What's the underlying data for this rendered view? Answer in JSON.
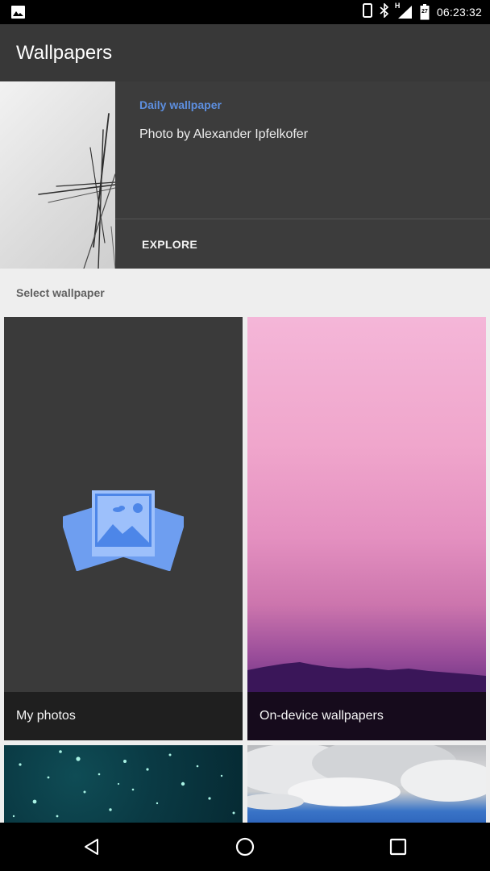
{
  "status_bar": {
    "time": "06:23:32",
    "network_label": "H",
    "battery_level": "27",
    "icons": [
      "gallery-notification-icon",
      "phone-icon",
      "bluetooth-icon",
      "signal-icon",
      "battery-icon"
    ]
  },
  "app_bar": {
    "title": "Wallpapers"
  },
  "daily": {
    "label": "Daily wallpaper",
    "credit": "Photo by Alexander Ipfelkofer",
    "explore_label": "EXPLORE"
  },
  "section": {
    "header": "Select wallpaper"
  },
  "tiles": [
    {
      "label": "My photos",
      "icon": "photos-icon"
    },
    {
      "label": "On-device wallpapers"
    },
    {
      "label": ""
    },
    {
      "label": ""
    }
  ],
  "nav": {
    "icons": [
      "back-icon",
      "home-icon",
      "recents-icon"
    ]
  },
  "colors": {
    "accent": "#5d8fe0",
    "app_bar": "#383838",
    "card": "#3c3c3c",
    "background": "#eeeeee"
  }
}
